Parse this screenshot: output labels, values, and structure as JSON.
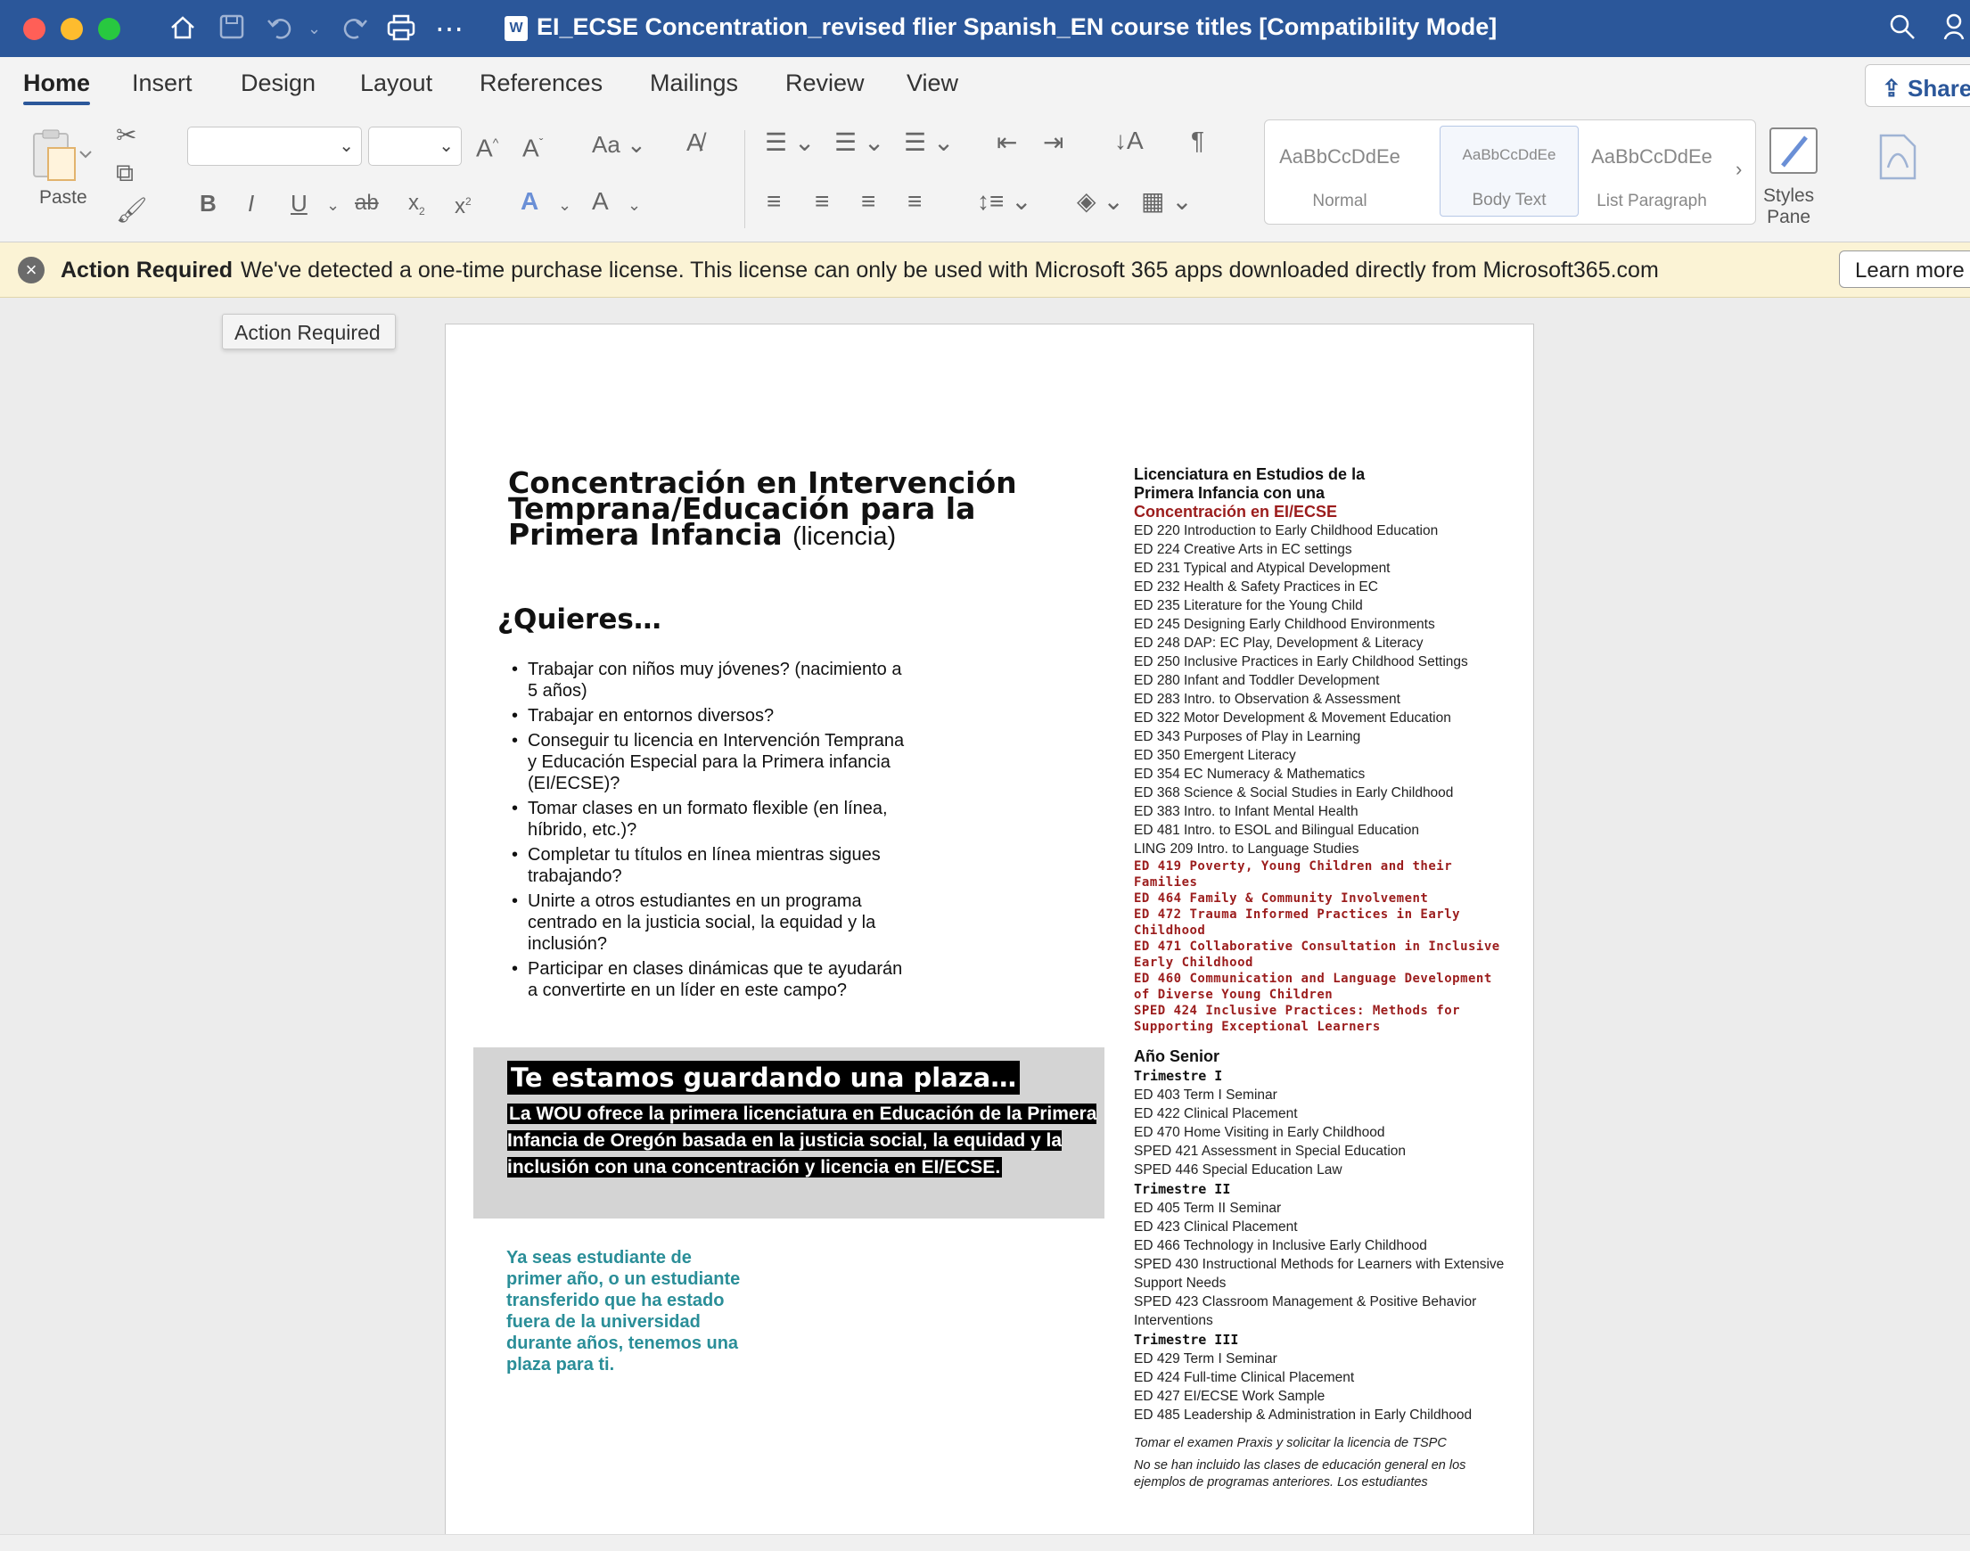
{
  "window": {
    "title": "EI_ECSE Concentration_revised flier Spanish_EN course titles [Compatibility Mode]"
  },
  "tabs": [
    "Home",
    "Insert",
    "Design",
    "Layout",
    "References",
    "Mailings",
    "Review",
    "View"
  ],
  "ribbon": {
    "share_label": "Share",
    "paste_label": "Paste",
    "styles": [
      {
        "sample": "AaBbCcDdEe",
        "name": "Normal"
      },
      {
        "sample": "AaBbCcDdEe",
        "name": "Body Text"
      },
      {
        "sample": "AaBbCcDdEe",
        "name": "List Paragraph"
      }
    ],
    "styles_pane_label_1": "Styles",
    "styles_pane_label_2": "Pane"
  },
  "banner": {
    "title": "Action Required",
    "message": "We've detected a one-time purchase license. This license can only be used with Microsoft 365 apps downloaded directly from Microsoft365.com",
    "button": "Learn more"
  },
  "tooltip": "Action Required",
  "doc": {
    "heading": [
      "Concentración en Intervención",
      "Temprana/Educación para la",
      "Primera Infancia"
    ],
    "heading_suffix": "(licencia)",
    "quieres": "¿Quieres…",
    "bullets": [
      "Trabajar con niños muy jóvenes? (nacimiento a 5 años)",
      "Trabajar en entornos diversos?",
      "Conseguir tu licencia en Intervención Temprana y Educación Especial para la Primera infancia (EI/ECSE)?",
      "Tomar clases en un formato flexible (en línea, híbrido, etc.)?",
      "Completar tu títulos en línea mientras sigues trabajando?",
      "Unirte a otros estudiantes en un programa centrado en la justicia social, la equidad y la inclusión?",
      "Participar en clases dinámicas que te ayudarán a convertirte en un líder en este campo?"
    ],
    "box_heading": "Te estamos guardando una plaza…",
    "box_body": "La WOU ofrece la primera licenciatura en Educación de la Primera Infancia de Oregón basada en la justicia social, la equidad y la inclusión con una concentración y licencia en EI/ECSE.",
    "teal_note": "Ya seas estudiante de primer año, o un estudiante transferido que ha estado fuera de la universidad durante años, tenemos una plaza para ti.",
    "right": {
      "heading": [
        "Licenciatura en Estudios de la",
        "Primera Infancia con una"
      ],
      "heading_red": "Concentración en EI/ECSE",
      "courses": [
        " ED 220 Introduction to Early Childhood Education",
        "ED 224 Creative Arts in EC settings",
        "ED 231 Typical and Atypical Development",
        "ED 232 Health & Safety Practices in EC",
        "ED 235 Literature for the Young Child",
        "ED 245 Designing Early Childhood Environments",
        "ED 248 DAP: EC Play, Development & Literacy",
        "ED 250 Inclusive Practices in Early Childhood Settings",
        "ED 280 Infant and Toddler Development",
        "ED 283 Intro. to Observation & Assessment",
        "ED 322 Motor Development & Movement Education",
        "ED 343 Purposes of Play in Learning",
        "ED 350 Emergent Literacy",
        "ED 354 EC Numeracy & Mathematics",
        "ED 368 Science & Social Studies in Early Childhood",
        "ED 383 Intro. to Infant Mental Health",
        "ED 481 Intro. to ESOL and Bilingual Education",
        "LING 209 Intro. to Language Studies"
      ],
      "red_courses": [
        "ED 419 Poverty, Young Children and their Families",
        "ED 464 Family & Community Involvement",
        "ED 472 Trauma Informed Practices in Early Childhood",
        "ED 471 Collaborative Consultation in Inclusive Early Childhood",
        "ED 460 Communication and Language Development of Diverse Young Children",
        "SPED 424 Inclusive Practices: Methods for Supporting Exceptional Learners"
      ],
      "senior": "Año Senior",
      "terms": [
        {
          "name": "Trimestre I",
          "courses": [
            "ED 403 Term I Seminar",
            "ED 422 Clinical Placement",
            "ED 470 Home Visiting in Early Childhood",
            "SPED 421 Assessment in Special Education",
            "SPED 446 Special Education Law"
          ]
        },
        {
          "name": "Trimestre II",
          "courses": [
            "ED 405 Term II Seminar",
            "ED 423 Clinical Placement",
            "ED 466 Technology in Inclusive Early Childhood",
            "SPED 430 Instructional Methods for Learners with Extensive Support Needs",
            "SPED 423 Classroom Management & Positive Behavior Interventions"
          ]
        },
        {
          "name": "Trimestre III",
          "courses": [
            "ED 429 Term I Seminar",
            "ED 424 Full-time Clinical Placement",
            "ED 427 EI/ECSE Work Sample",
            "ED 485 Leadership & Administration in Early Childhood"
          ]
        }
      ],
      "note1": "Tomar el examen Praxis y solicitar la licencia de TSPC",
      "note2": "No se han incluido las clases de educación general en los ejemplos de programas anteriores. Los estudiantes"
    }
  }
}
